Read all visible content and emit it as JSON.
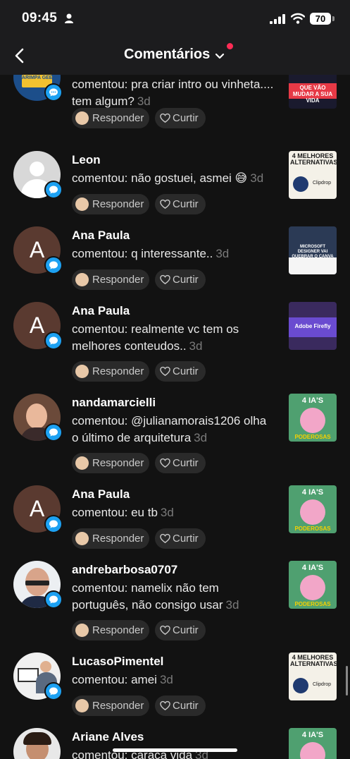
{
  "status_bar": {
    "time": "09:45",
    "battery": "70"
  },
  "header": {
    "title": "Comentários"
  },
  "actions": {
    "reply_label": "Responder",
    "like_label": "Curtir"
  },
  "comments": [
    {
      "username": "",
      "text": "comentou: pra criar intro ou vinheta.... tem algum?",
      "ago": "3d",
      "avatar_text": "GARIMPA GEEK",
      "thumb_text": "QUE VÃO MUDAR A SUA VIDA"
    },
    {
      "username": "Leon",
      "text": "comentou: não gostuei, asmei 😅",
      "ago": "3d",
      "thumb_text": "4 MELHORES ALTERNATIVAS",
      "thumb_sub": "Clipdrop"
    },
    {
      "username": "Ana Paula",
      "text": "comentou: q interessante..",
      "ago": "3d",
      "avatar_text": "A",
      "thumb_text": "MICROSOFT DESIGNER VAI QUEBRAR O CANVA"
    },
    {
      "username": "Ana Paula",
      "text": "comentou: realmente vc tem os melhores conteudos..",
      "ago": "3d",
      "avatar_text": "A",
      "thumb_text": "Adobe Firefly"
    },
    {
      "username": "nandamarcielli",
      "text": "comentou: @julianamorais1206 olha o último de arquitetura",
      "ago": "3d",
      "thumb_text": "4 IA'S",
      "thumb_sub": "PODEROSAS"
    },
    {
      "username": "Ana Paula",
      "text": "comentou: eu tb",
      "ago": "3d",
      "avatar_text": "A",
      "thumb_text": "4 IA'S",
      "thumb_sub": "PODEROSAS"
    },
    {
      "username": "andrebarbosa0707",
      "text": "comentou: namelix não tem português, não consigo usar",
      "ago": "3d",
      "thumb_text": "4 IA'S",
      "thumb_sub": "PODEROSAS"
    },
    {
      "username": "LucasoPimentel",
      "text": "comentou: amei",
      "ago": "3d",
      "thumb_text": "4 MELHORES ALTERNATIVAS",
      "thumb_sub": "Clipdrop"
    },
    {
      "username": "Ariane Alves",
      "text": "comentou: caraca vida",
      "ago": "3d",
      "thumb_text": "4 IA'S"
    }
  ]
}
